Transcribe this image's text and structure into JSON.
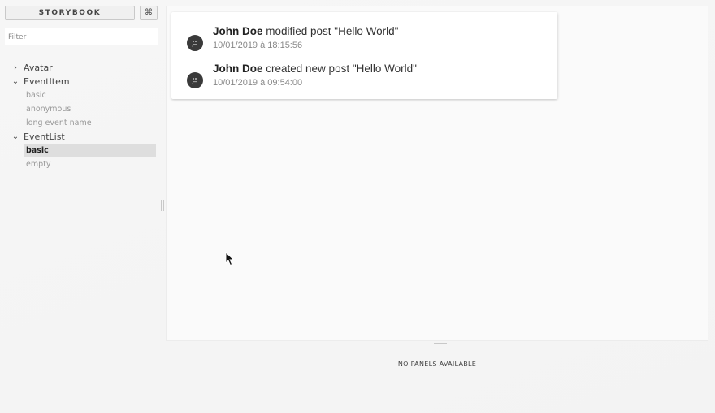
{
  "sidebar": {
    "brand": "STORYBOOK",
    "shortcuts_icon": "command-icon",
    "filter_placeholder": "Filter",
    "kinds": [
      {
        "label": "Avatar",
        "expanded": false,
        "stories": []
      },
      {
        "label": "EventItem",
        "expanded": true,
        "stories": [
          "basic",
          "anonymous",
          "long event name"
        ]
      },
      {
        "label": "EventList",
        "expanded": true,
        "stories": [
          "basic",
          "empty"
        ],
        "selected_story": "basic"
      }
    ]
  },
  "preview": {
    "events": [
      {
        "author": "John Doe",
        "action": " modified post \"Hello World\"",
        "date": "10/01/2019 à 18:15:56"
      },
      {
        "author": "John Doe",
        "action": " created new post \"Hello World\"",
        "date": "10/01/2019 à 09:54:00"
      }
    ]
  },
  "addons": {
    "empty_message": "NO PANELS AVAILABLE"
  },
  "colors": {
    "background": "#f4f4f4",
    "preview_bg": "#fafafa",
    "card_bg": "#ffffff",
    "avatar_bg": "#3a3a3a",
    "selected_row_bg": "#dedede"
  }
}
